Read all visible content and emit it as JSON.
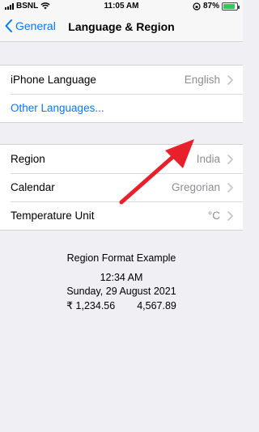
{
  "status_bar": {
    "carrier": "BSNL",
    "time": "11:05 AM",
    "battery": "87%",
    "battery_level": 0.87
  },
  "nav": {
    "back_label": "General",
    "title": "Language & Region"
  },
  "language_group": {
    "iphone_language_label": "iPhone Language",
    "iphone_language_value": "English",
    "other_languages_label": "Other Languages..."
  },
  "region_group": {
    "region_label": "Region",
    "region_value": "India",
    "calendar_label": "Calendar",
    "calendar_value": "Gregorian",
    "temperature_label": "Temperature Unit",
    "temperature_value": "°C"
  },
  "format_example": {
    "heading": "Region Format Example",
    "time": "12:34 AM",
    "date": "Sunday, 29 August 2021",
    "currency": "₹ 1,234.56",
    "number": "4,567.89"
  },
  "colors": {
    "accent": "#007aff",
    "background": "#efeff4",
    "annotation_arrow": "#e8202a"
  }
}
